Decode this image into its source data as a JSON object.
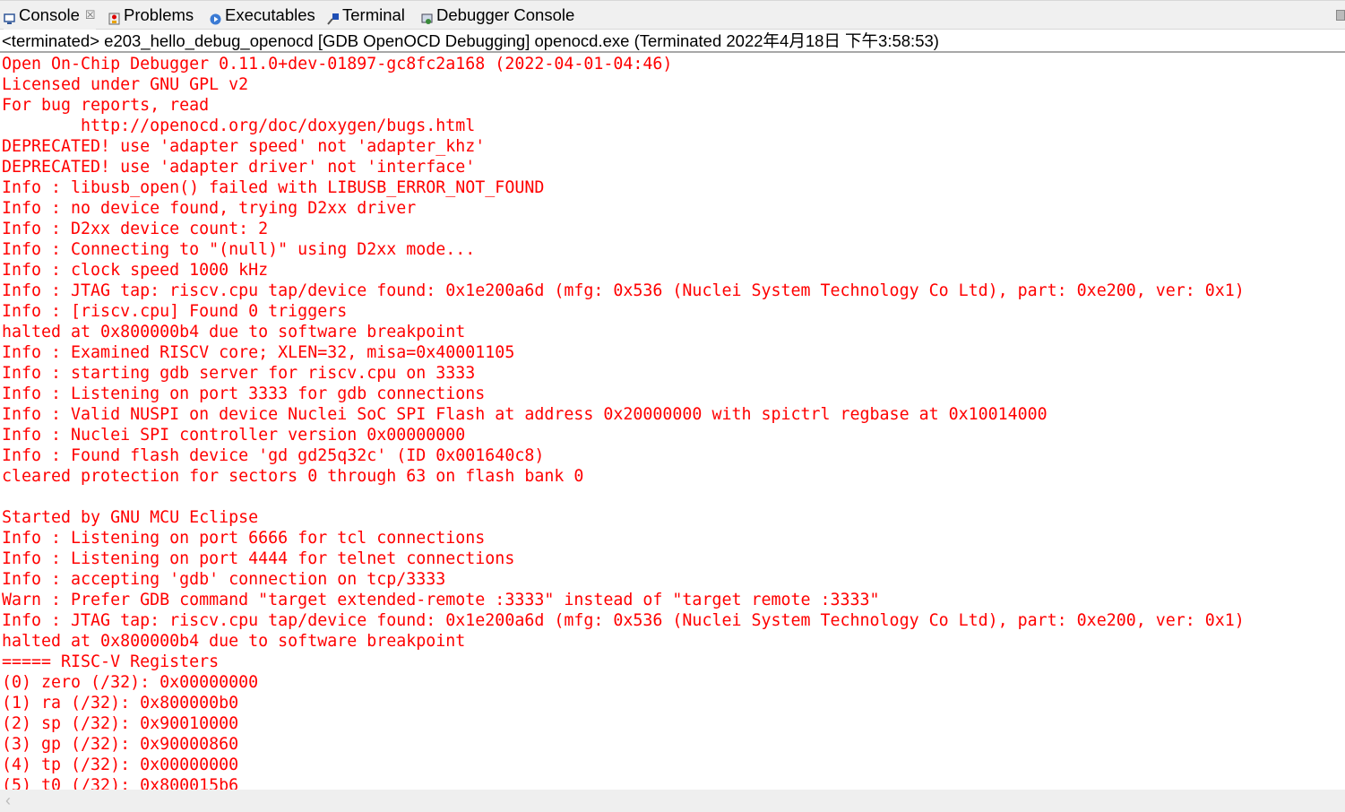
{
  "tabs": [
    {
      "label": "Console",
      "icon": "console-icon",
      "active": true
    },
    {
      "label": "Problems",
      "icon": "problems-icon"
    },
    {
      "label": "Executables",
      "icon": "executables-icon"
    },
    {
      "label": "Terminal",
      "icon": "terminal-icon"
    },
    {
      "label": "Debugger Console",
      "icon": "debugger-console-icon"
    }
  ],
  "status": "<terminated> e203_hello_debug_openocd [GDB OpenOCD Debugging] openocd.exe (Terminated 2022年4月18日 下午3:58:53)",
  "colors": {
    "output": "#ff0000"
  },
  "lines": [
    "Open On-Chip Debugger 0.11.0+dev-01897-gc8fc2a168 (2022-04-01-04:46)",
    "Licensed under GNU GPL v2",
    "For bug reports, read",
    "\thttp://openocd.org/doc/doxygen/bugs.html",
    "DEPRECATED! use 'adapter speed' not 'adapter_khz'",
    "DEPRECATED! use 'adapter driver' not 'interface'",
    "Info : libusb_open() failed with LIBUSB_ERROR_NOT_FOUND",
    "Info : no device found, trying D2xx driver",
    "Info : D2xx device count: 2",
    "Info : Connecting to \"(null)\" using D2xx mode...",
    "Info : clock speed 1000 kHz",
    "Info : JTAG tap: riscv.cpu tap/device found: 0x1e200a6d (mfg: 0x536 (Nuclei System Technology Co Ltd), part: 0xe200, ver: 0x1)",
    "Info : [riscv.cpu] Found 0 triggers",
    "halted at 0x800000b4 due to software breakpoint",
    "Info : Examined RISCV core; XLEN=32, misa=0x40001105",
    "Info : starting gdb server for riscv.cpu on 3333",
    "Info : Listening on port 3333 for gdb connections",
    "Info : Valid NUSPI on device Nuclei SoC SPI Flash at address 0x20000000 with spictrl regbase at 0x10014000",
    "Info : Nuclei SPI controller version 0x00000000",
    "Info : Found flash device 'gd gd25q32c' (ID 0x001640c8)",
    "cleared protection for sectors 0 through 63 on flash bank 0",
    "",
    "Started by GNU MCU Eclipse",
    "Info : Listening on port 6666 for tcl connections",
    "Info : Listening on port 4444 for telnet connections",
    "Info : accepting 'gdb' connection on tcp/3333",
    "Warn : Prefer GDB command \"target extended-remote :3333\" instead of \"target remote :3333\"",
    "Info : JTAG tap: riscv.cpu tap/device found: 0x1e200a6d (mfg: 0x536 (Nuclei System Technology Co Ltd), part: 0xe200, ver: 0x1)",
    "halted at 0x800000b4 due to software breakpoint",
    "===== RISC-V Registers",
    "(0) zero (/32): 0x00000000",
    "(1) ra (/32): 0x800000b0",
    "(2) sp (/32): 0x90010000",
    "(3) gp (/32): 0x90000860",
    "(4) tp (/32): 0x00000000",
    "(5) t0 (/32): 0x800015b6"
  ]
}
